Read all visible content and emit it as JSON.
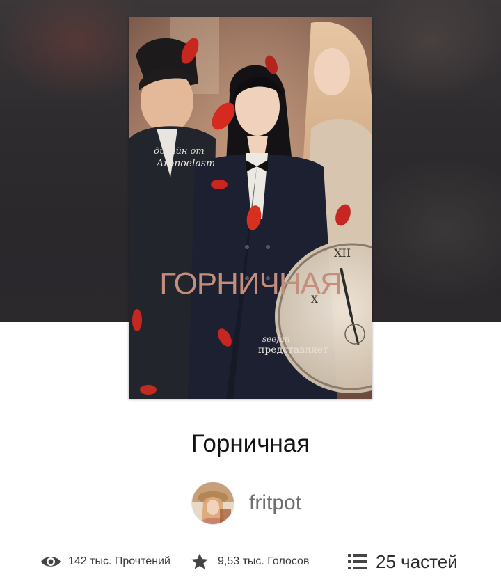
{
  "story": {
    "title": "Горничная",
    "cover": {
      "title_text": "ГОРНИЧНАЯ",
      "credit_line1": "дизайн от",
      "credit_line2": "Aronoelasm",
      "presents_line1": "seefan",
      "presents_line2": "представляет"
    }
  },
  "author": {
    "name": "fritpot",
    "avatar_icon": "author-avatar-photo"
  },
  "stats": {
    "reads": "142 тыс. Прочтений",
    "votes": "9,53 тыс. Голосов",
    "parts": "25 частей"
  },
  "colors": {
    "hero_background": "#2f2c2f",
    "title_text": "#121212",
    "author_text": "#6f6f6f",
    "icon": "#444444"
  }
}
